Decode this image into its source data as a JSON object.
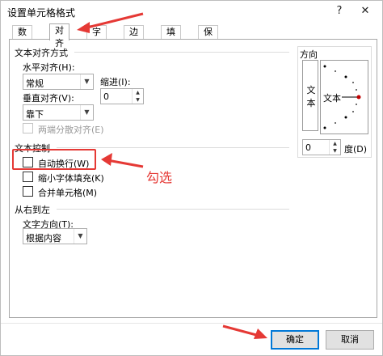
{
  "dialog": {
    "title": "设置单元格格式",
    "help_label": "?",
    "close_label": "✕"
  },
  "tabs": [
    "数字",
    "对齐",
    "字体",
    "边框",
    "填充",
    "保护"
  ],
  "text_alignment": {
    "group_label": "文本对齐方式",
    "horizontal_label": "水平对齐(H):",
    "horizontal_value": "常规",
    "vertical_label": "垂直对齐(V):",
    "vertical_value": "靠下",
    "indent_label": "缩进(I):",
    "indent_value": "0",
    "justify_distributed_label": "两端分散对齐(E)"
  },
  "text_control": {
    "group_label": "文本控制",
    "wrap_text_label": "自动换行(W)",
    "shrink_to_fit_label": "缩小字体填充(K)",
    "merge_cells_label": "合并单元格(M)"
  },
  "rtl": {
    "group_label": "从右到左",
    "direction_label": "文字方向(T):",
    "direction_value": "根据内容"
  },
  "orientation": {
    "group_label": "方向",
    "vertical_text_chars": [
      "文",
      "本"
    ],
    "dial_text": "文本",
    "degree_value": "0",
    "degree_unit": "度(D)"
  },
  "buttons": {
    "ok_label": "确定",
    "cancel_label": "取消"
  },
  "annotation": {
    "text": "勾选",
    "color": "#e53935"
  },
  "colors": {
    "accent": "#0078d7",
    "annotation": "#e53935"
  }
}
